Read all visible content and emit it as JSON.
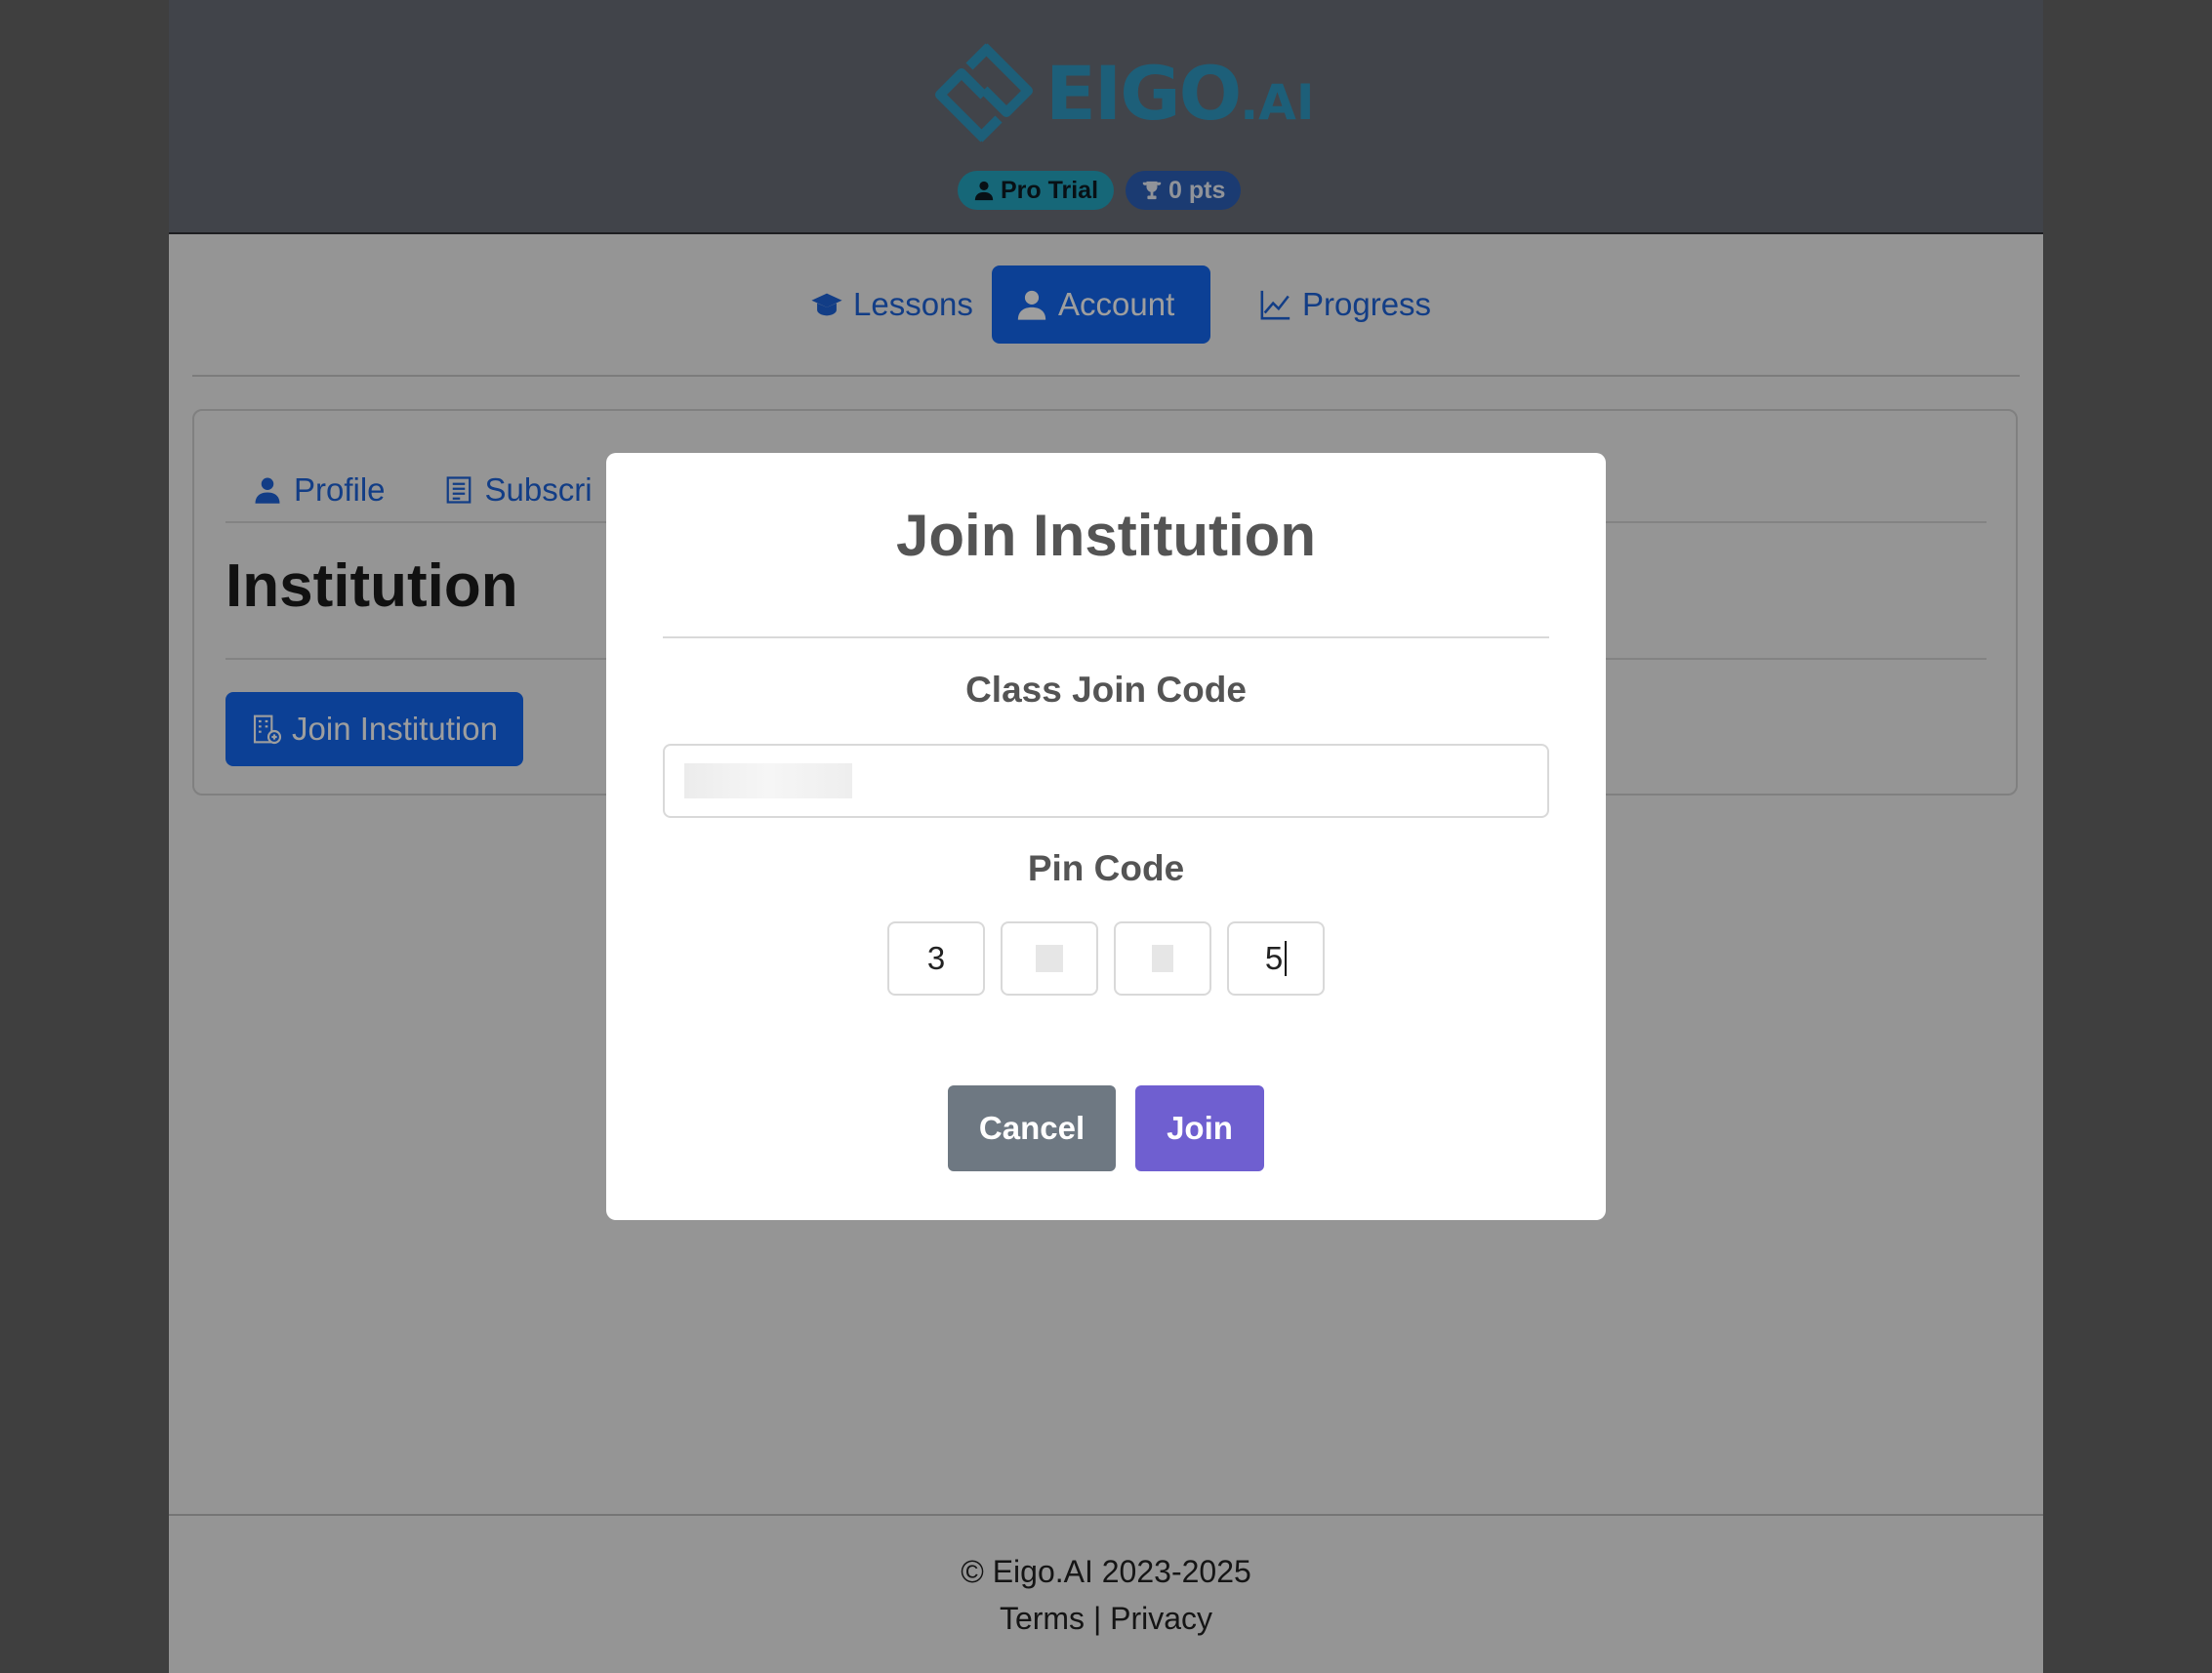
{
  "header": {
    "logo_text_main": "EIGO",
    "logo_text_suffix": ".AI",
    "badge_plan": "Pro Trial",
    "badge_points": "0 pts"
  },
  "nav": {
    "lessons": "Lessons",
    "account": "Account",
    "progress": "Progress"
  },
  "account": {
    "tabs": [
      "Profile",
      "Subscri"
    ],
    "section_title": "Institution",
    "join_button": "Join Institution"
  },
  "modal": {
    "title": "Join Institution",
    "class_code_label": "Class Join Code",
    "pin_label": "Pin Code",
    "pins": [
      "3",
      "",
      "",
      "5"
    ],
    "cancel_label": "Cancel",
    "join_label": "Join"
  },
  "footer": {
    "copyright": "© Eigo.AI 2023-2025",
    "terms": "Terms",
    "separator": "|",
    "privacy": "Privacy"
  },
  "colors": {
    "primary": "#1468f0",
    "join_button": "#6f5fd0",
    "cancel_button": "#6e7882",
    "logo": "#2f9ac4"
  }
}
